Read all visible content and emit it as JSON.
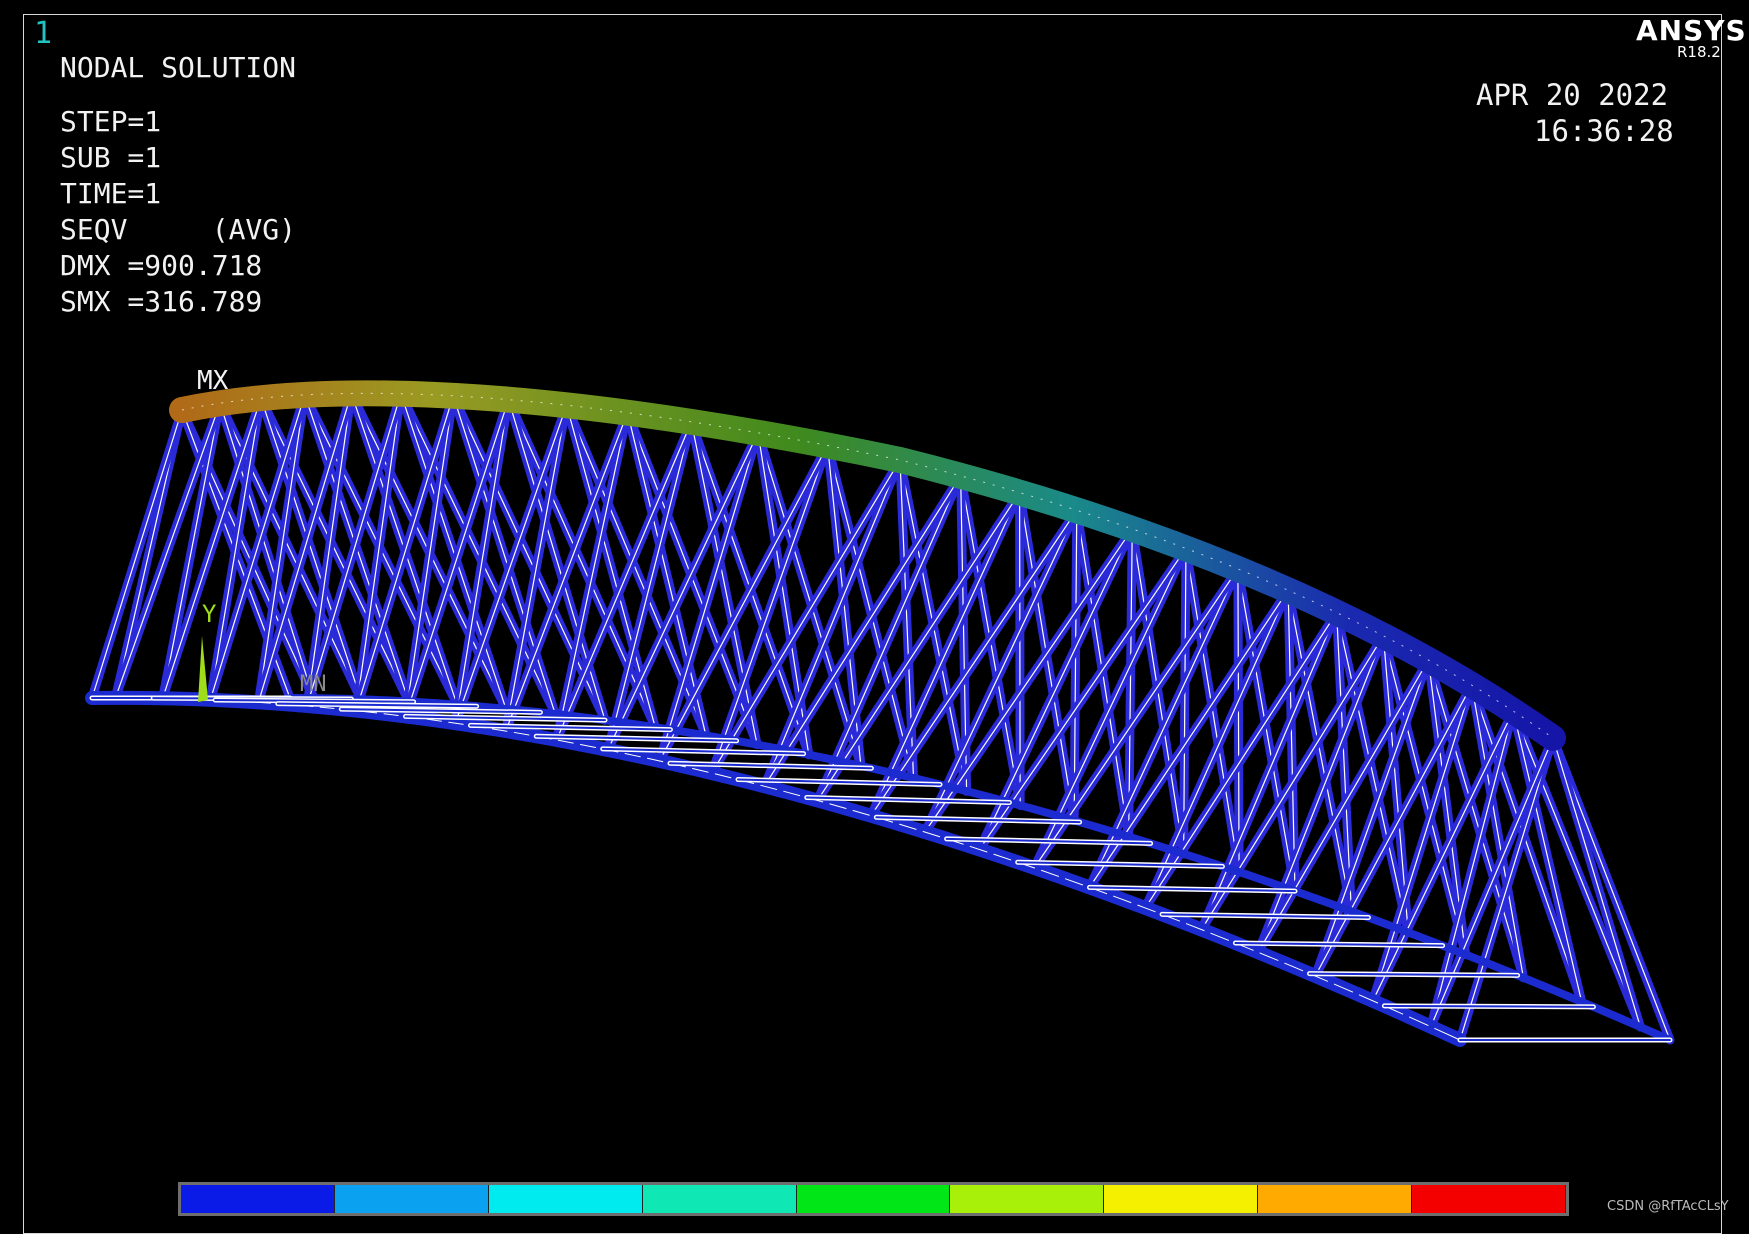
{
  "window": {
    "number": "1"
  },
  "header": {
    "brand": "ANSYS",
    "version": "R18.2",
    "date": "APR 20 2022",
    "time": "16:36:28"
  },
  "solution_info": {
    "title": "NODAL SOLUTION",
    "lines": [
      "STEP=1",
      "SUB =1",
      "TIME=1",
      "SEQV     (AVG)",
      "DMX =900.718",
      "SMX =316.789"
    ]
  },
  "plot": {
    "max_label": "MX",
    "axis_y_label": "Y",
    "axis_x_label": "MN"
  },
  "legend": {
    "colors": [
      "#0a1be8",
      "#0aa2f0",
      "#00ebf0",
      "#0fe8b4",
      "#00e616",
      "#a8f00a",
      "#f5f000",
      "#ffaa00",
      "#f50000"
    ]
  },
  "watermark": "CSDN @RfTAcCLsY",
  "colors": {
    "truss": "#2a2ad8",
    "edges": "#ffffff",
    "frame": "#d8d8d8",
    "background": "#000000"
  }
}
